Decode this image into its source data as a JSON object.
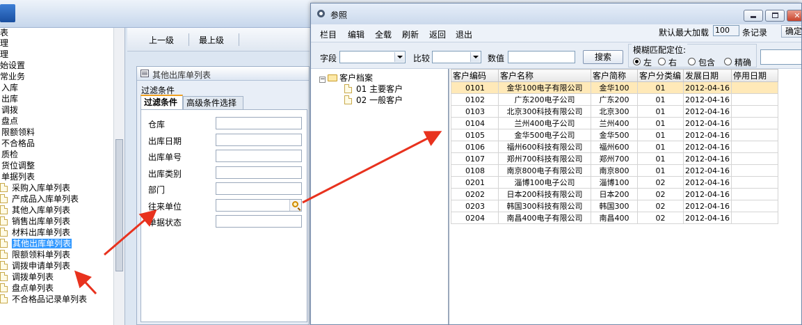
{
  "left_tree": {
    "items": [
      {
        "label": "表"
      },
      {
        "label": "理"
      },
      {
        "label": "理"
      },
      {
        "label": "始设置"
      },
      {
        "label": "常业务"
      },
      {
        "label": "入库"
      },
      {
        "label": "出库"
      },
      {
        "label": "调拨"
      },
      {
        "label": "盘点"
      },
      {
        "label": "限额领料"
      },
      {
        "label": "不合格品"
      },
      {
        "label": "质检"
      },
      {
        "label": "货位调整"
      },
      {
        "label": "单据列表"
      },
      {
        "label": "采购入库单列表"
      },
      {
        "label": "产成品入库单列表"
      },
      {
        "label": "其他入库单列表"
      },
      {
        "label": "销售出库单列表"
      },
      {
        "label": "材料出库单列表"
      },
      {
        "label": "其他出库单列表",
        "selected": true
      },
      {
        "label": "限额领料单列表"
      },
      {
        "label": "调拨申请单列表"
      },
      {
        "label": "调拨单列表"
      },
      {
        "label": "盘点单列表"
      },
      {
        "label": "不合格品记录单列表"
      }
    ]
  },
  "back_toolbar": {
    "up_level": "上一级",
    "top_level": "最上级"
  },
  "filter_panel": {
    "title": "其他出库单列表",
    "section_label": "过滤条件",
    "tabs": [
      "过滤条件",
      "高级条件选择"
    ],
    "fields": [
      {
        "label": "仓库"
      },
      {
        "label": "出库日期"
      },
      {
        "label": "出库单号"
      },
      {
        "label": "出库类别"
      },
      {
        "label": "部门"
      },
      {
        "label": "往来单位",
        "lookup": true
      },
      {
        "label": "单据状态"
      }
    ]
  },
  "ref_dialog": {
    "title": "参照",
    "menu": [
      "栏目",
      "编辑",
      "全载",
      "刷新",
      "返回",
      "退出"
    ],
    "max_load_label": "默认最大加载",
    "max_load_value": "100",
    "records_label": "条记录",
    "ok_button": "确定",
    "search": {
      "field_label": "字段",
      "compare_label": "比较",
      "value_label": "数值",
      "search_button": "搜索",
      "fuzzy_title": "模糊匹配定位:",
      "options": [
        "左",
        "右",
        "包含",
        "精确"
      ],
      "selected_option": "左"
    },
    "tree": {
      "root": "客户档案",
      "children": [
        "01 主要客户",
        "02 一般客户"
      ]
    },
    "table": {
      "columns": [
        "客户编码",
        "客户名称",
        "客户简称",
        "客户分类编",
        "发展日期",
        "停用日期"
      ],
      "rows": [
        [
          "0101",
          "金华100电子有限公司",
          "金华100",
          "01",
          "2012-04-16",
          ""
        ],
        [
          "0102",
          "广东200电子公司",
          "广东200",
          "01",
          "2012-04-16",
          ""
        ],
        [
          "0103",
          "北京300科技有限公司",
          "北京300",
          "01",
          "2012-04-16",
          ""
        ],
        [
          "0104",
          "兰州400电子公司",
          "兰州400",
          "01",
          "2012-04-16",
          ""
        ],
        [
          "0105",
          "金华500电子公司",
          "金华500",
          "01",
          "2012-04-16",
          ""
        ],
        [
          "0106",
          "福州600科技有限公司",
          "福州600",
          "01",
          "2012-04-16",
          ""
        ],
        [
          "0107",
          "郑州700科技有限公司",
          "郑州700",
          "01",
          "2012-04-16",
          ""
        ],
        [
          "0108",
          "南京800电子有限公司",
          "南京800",
          "01",
          "2012-04-16",
          ""
        ],
        [
          "0201",
          "淄博100电子公司",
          "淄博100",
          "02",
          "2012-04-16",
          ""
        ],
        [
          "0202",
          "日本200科技有限公司",
          "日本200",
          "02",
          "2012-04-16",
          ""
        ],
        [
          "0203",
          "韩国300科技有限公司",
          "韩国300",
          "02",
          "2012-04-16",
          ""
        ],
        [
          "0204",
          "南昌400电子有限公司",
          "南昌400",
          "02",
          "2012-04-16",
          ""
        ]
      ],
      "selected_row": 0
    }
  },
  "colors": {
    "annotation_arrow": "#e8321e",
    "selection": "#3399ff",
    "row_highlight": "#ffe9b8"
  }
}
